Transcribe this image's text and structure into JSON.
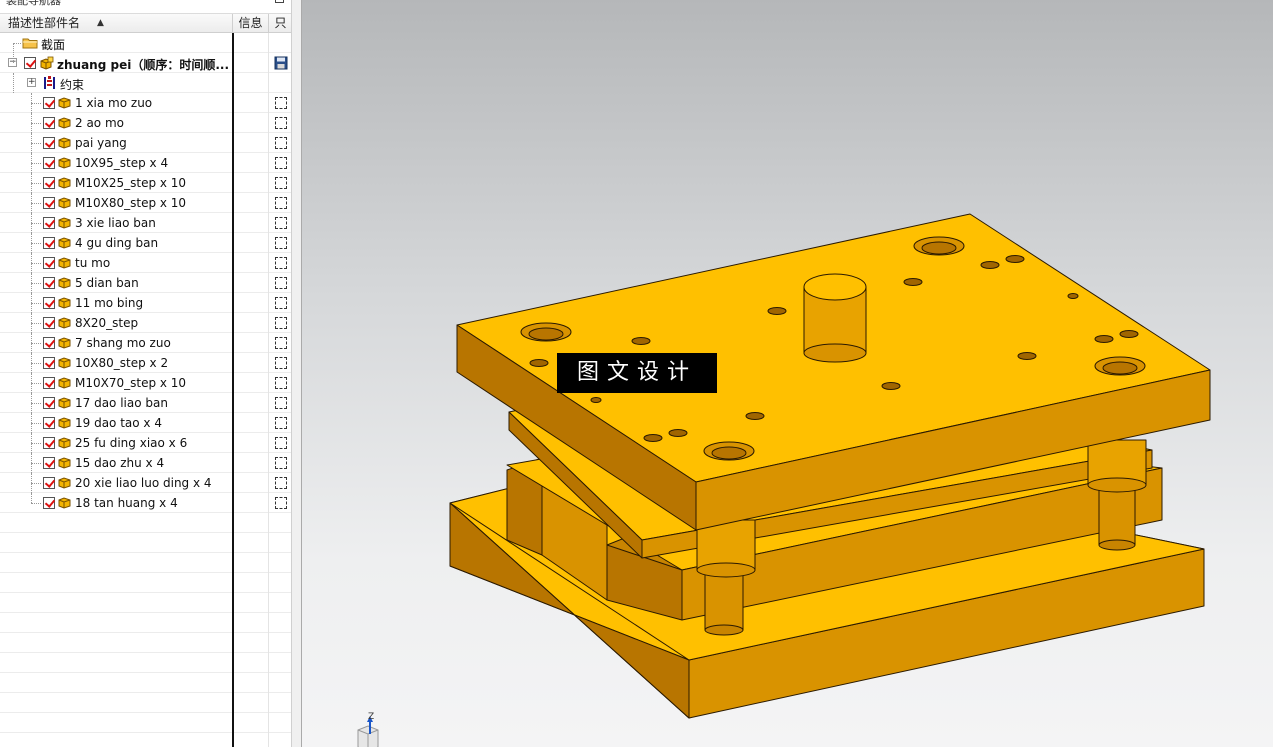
{
  "navigator": {
    "title": "装配导航器",
    "columns": {
      "name": "描述性部件名",
      "info": "信息",
      "readonly": "只"
    },
    "section_folder": "截面",
    "root": "zhuang pei（顺序：时间顺...",
    "constraints": "约束",
    "parts": [
      "1 xia mo zuo",
      "2 ao mo",
      "pai yang",
      "10X95_step x 4",
      "M10X25_step x 10",
      "M10X80_step x 10",
      "3 xie liao ban",
      "4 gu ding ban",
      "tu mo",
      "5 dian ban",
      "11 mo bing",
      "8X20_step",
      "7 shang mo zuo",
      "10X80_step x 2",
      "M10X70_step x 10",
      "17 dao liao ban",
      "19 dao tao x 4",
      "25 fu ding xiao x 6",
      "15 dao zhu x 4",
      "20 xie liao luo ding x 4",
      "18 tan huang x 4"
    ]
  },
  "viewport": {
    "watermark": "图文设计",
    "triad_z": "Z"
  },
  "colors": {
    "part_light": "#ffc000",
    "part_mid": "#e8a300",
    "part_dark": "#b87500",
    "edge": "#2b1a00",
    "checkbox_mark": "#dd1111"
  }
}
